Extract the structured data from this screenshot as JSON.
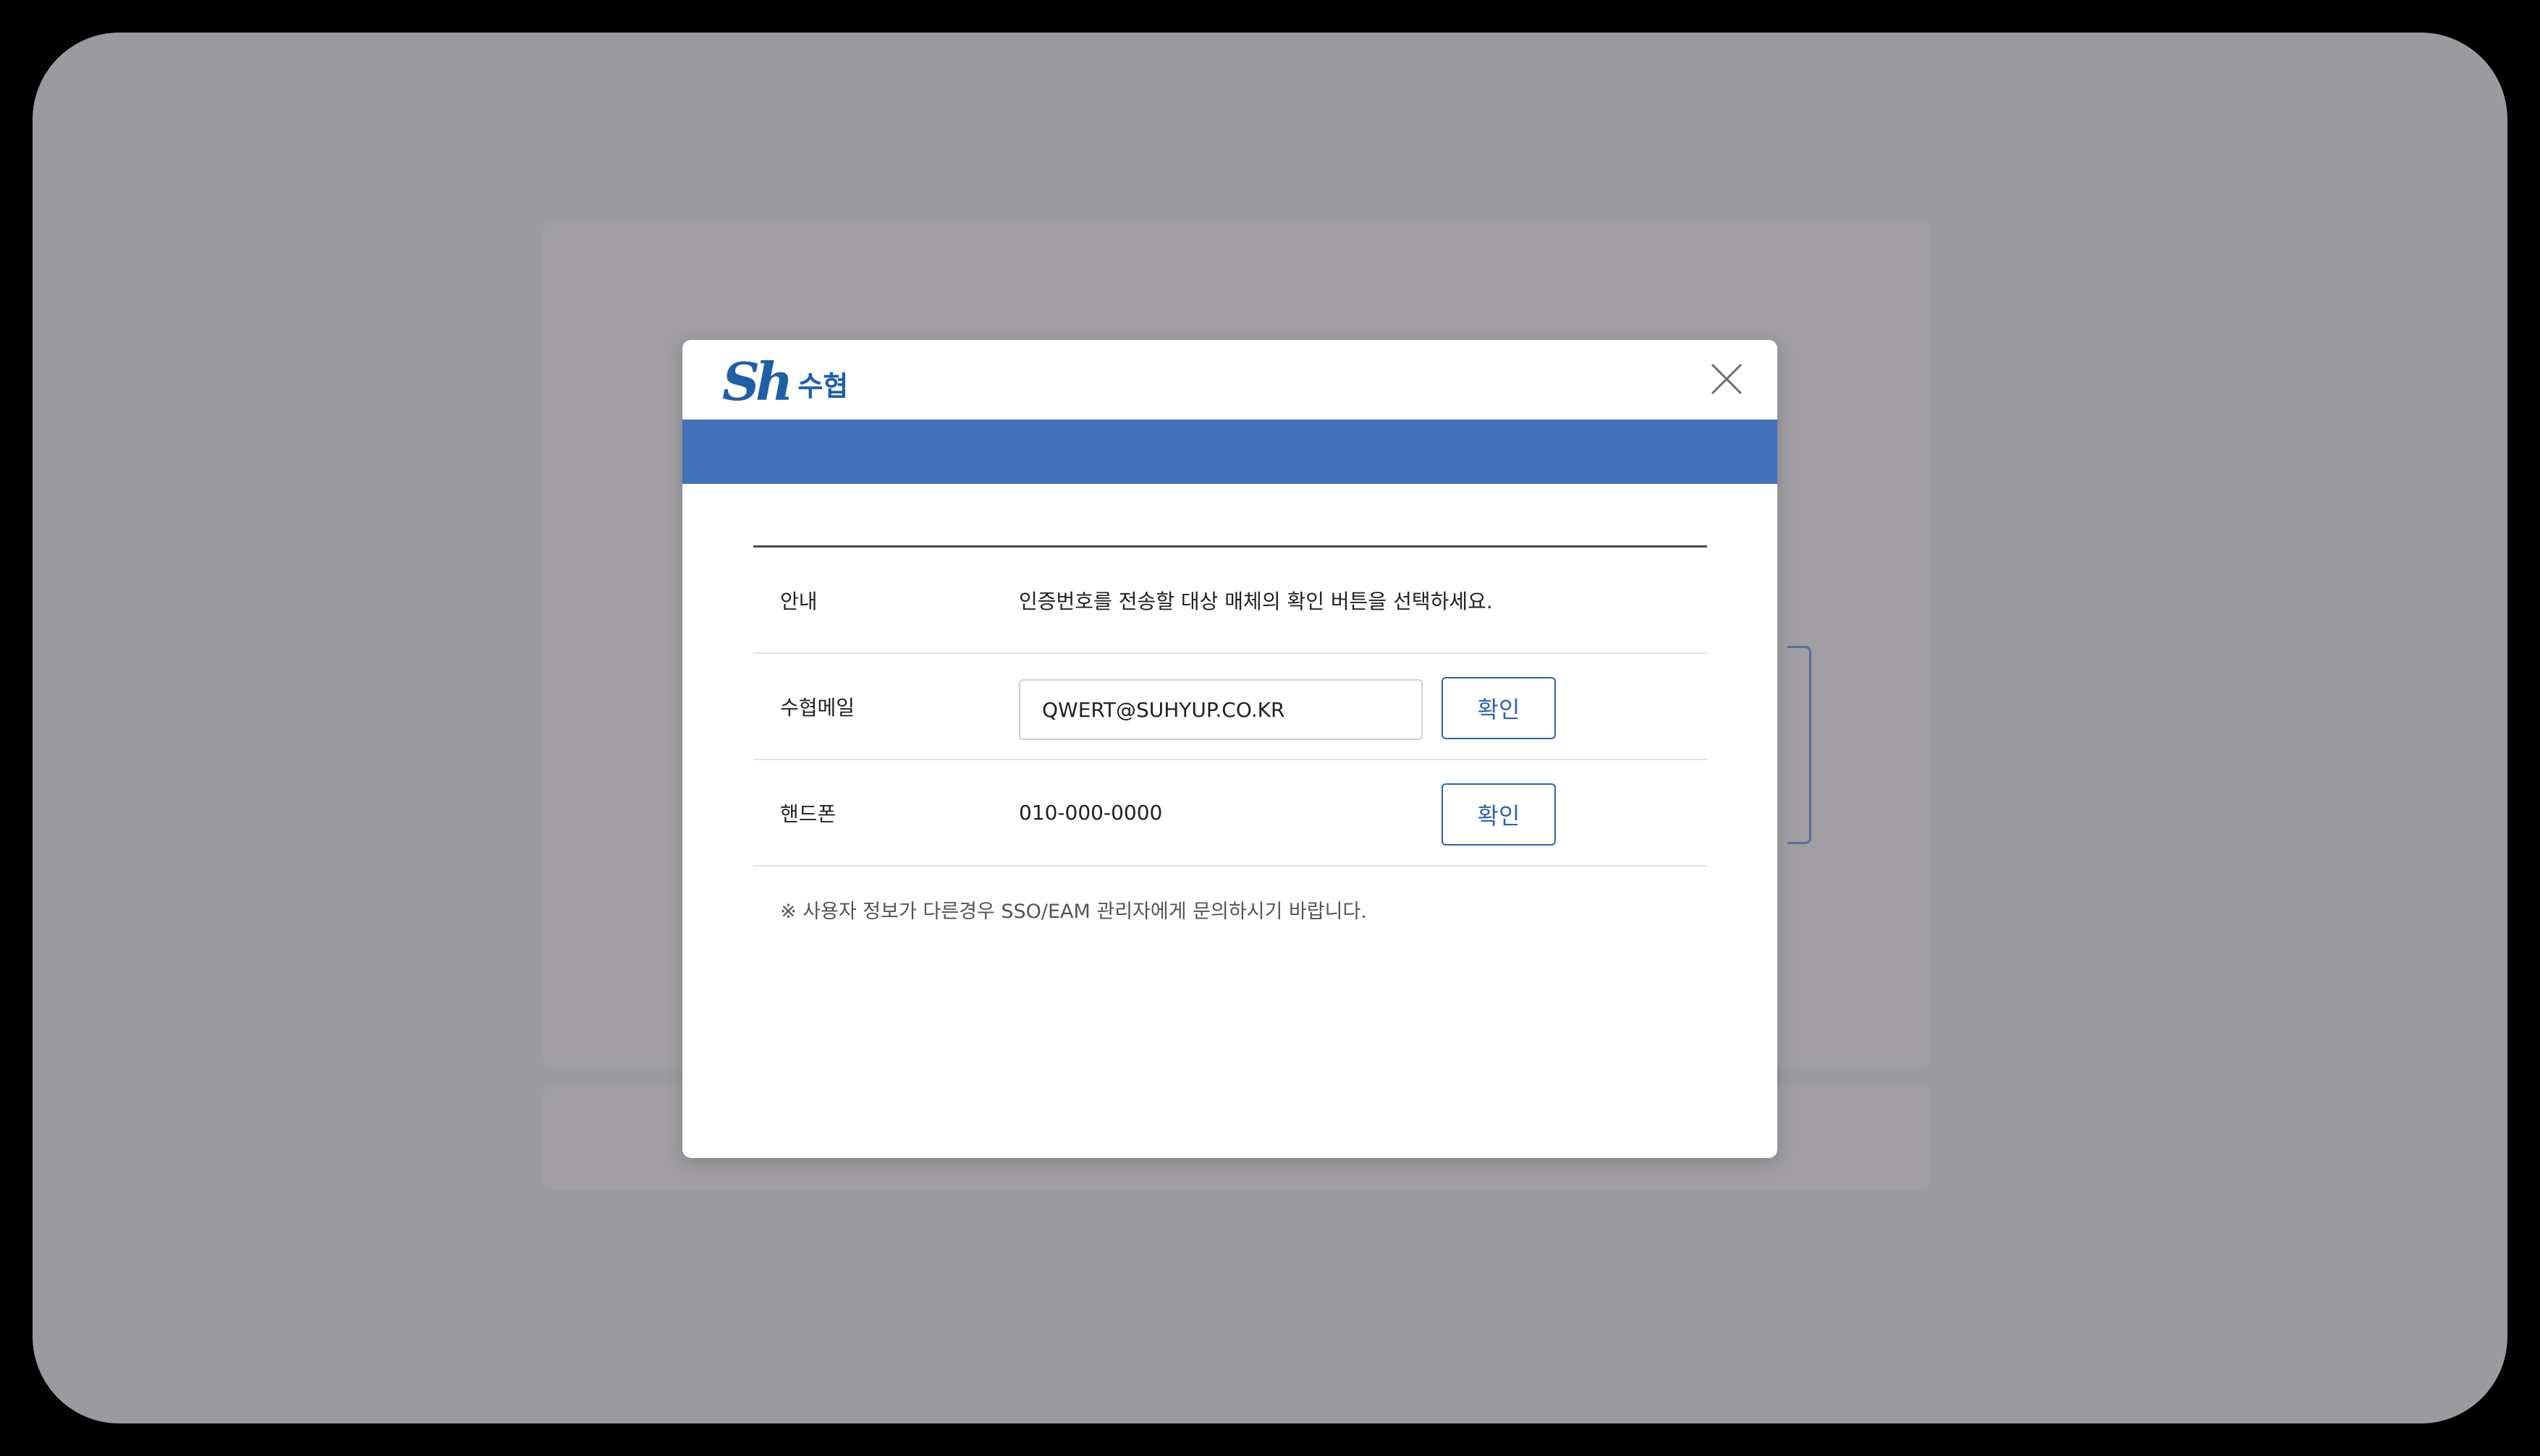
{
  "modal": {
    "logo": {
      "mark": "Sh",
      "text": "수협"
    },
    "close_icon": "close-icon"
  },
  "table": {
    "rows": [
      {
        "label": "안내",
        "value": "인증번호를 전송할 대상 매체의 확인 버튼을 선택하세요."
      },
      {
        "label": "수협메일",
        "input_value": "QWERT@SUHYUP.CO.KR",
        "button": "확인"
      },
      {
        "label": "핸드폰",
        "value": "010-000-0000",
        "button": "확인"
      }
    ],
    "notice": "※ 사용자 정보가 다른경우 SSO/EAM 관리자에게 문의하시기 바랍니다."
  },
  "colors": {
    "brand": "#1f5fa8",
    "header_bar": "#4372b8",
    "button_accent": "#2f63b0",
    "overlay": "#9a9a9f"
  }
}
